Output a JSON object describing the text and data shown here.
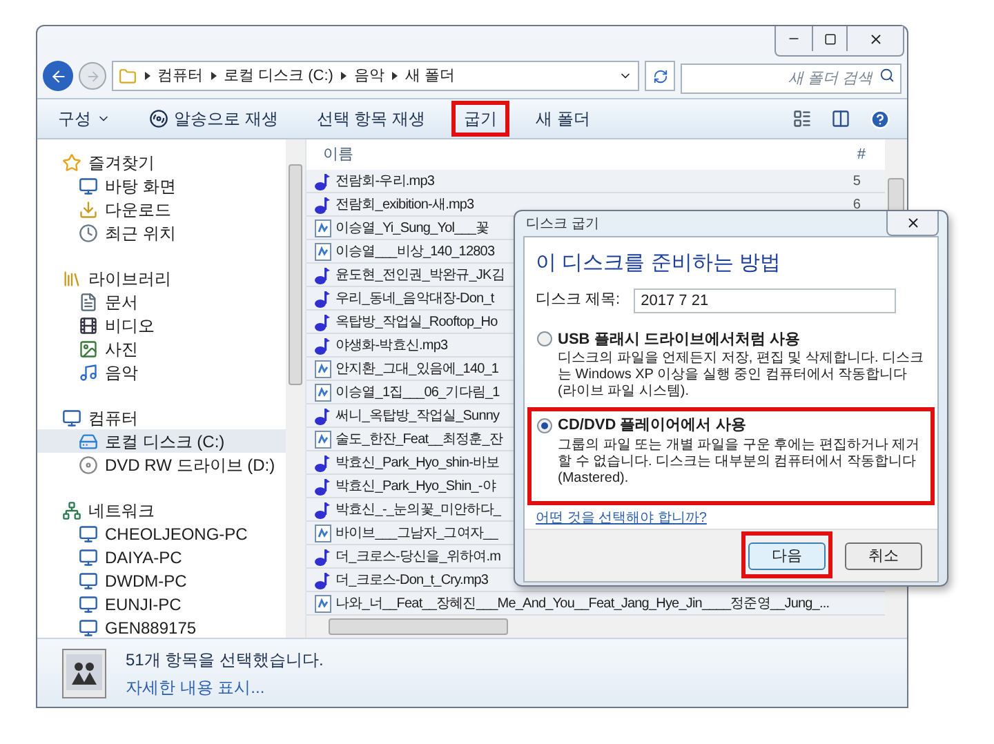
{
  "address": {
    "path": [
      {
        "label": "컴퓨터"
      },
      {
        "label": "로컬 디스크 (C:)"
      },
      {
        "label": "음악"
      },
      {
        "label": "새 폴더"
      }
    ],
    "search": {
      "placeholder": "새 폴더 검색"
    }
  },
  "toolbar": [
    {
      "label": "구성",
      "kind": "menu",
      "highlighted": false
    },
    {
      "label": "알송으로 재생",
      "kind": "play",
      "highlighted": false
    },
    {
      "label": "선택 항목 재생",
      "kind": "plain",
      "highlighted": false
    },
    {
      "label": "굽기",
      "kind": "plain",
      "highlighted": true
    },
    {
      "label": "새 폴더",
      "kind": "plain",
      "highlighted": false
    }
  ],
  "sidebar": {
    "sections": [
      {
        "label": "즐겨찾기",
        "kind": "star",
        "selected": false,
        "children": [
          {
            "label": "바탕 화면",
            "kind": "desktop",
            "selected": false
          },
          {
            "label": "다운로드",
            "kind": "download",
            "selected": false
          },
          {
            "label": "최근 위치",
            "kind": "recent",
            "selected": false
          }
        ]
      },
      {
        "label": "라이브러리",
        "kind": "library",
        "selected": false,
        "children": [
          {
            "label": "문서",
            "kind": "doc",
            "selected": false
          },
          {
            "label": "비디오",
            "kind": "video",
            "selected": false
          },
          {
            "label": "사진",
            "kind": "photo",
            "selected": false
          },
          {
            "label": "음악",
            "kind": "music",
            "selected": false
          }
        ]
      },
      {
        "label": "컴퓨터",
        "kind": "computer",
        "selected": false,
        "children": [
          {
            "label": "로컬 디스크 (C:)",
            "kind": "disk",
            "selected": true
          },
          {
            "label": "DVD RW 드라이브 (D:)",
            "kind": "dvd",
            "selected": false
          }
        ]
      },
      {
        "label": "네트워크",
        "kind": "network",
        "selected": false,
        "children": [
          {
            "label": "CHEOLJEONG-PC",
            "kind": "computer",
            "selected": false
          },
          {
            "label": "DAIYA-PC",
            "kind": "computer",
            "selected": false
          },
          {
            "label": "DWDM-PC",
            "kind": "computer",
            "selected": false
          },
          {
            "label": "EUNJI-PC",
            "kind": "computer",
            "selected": false
          },
          {
            "label": "GEN889175",
            "kind": "computer",
            "selected": false
          }
        ]
      }
    ]
  },
  "table": {
    "columns": [
      {
        "label": "이름"
      },
      {
        "label": "#"
      }
    ],
    "rows": [
      {
        "name": "전람회-우리.mp3",
        "number": "5",
        "kind": "note",
        "selected": true
      },
      {
        "name": "전람회_exibition-새.mp3",
        "number": "6",
        "kind": "note",
        "selected": true
      },
      {
        "name": "이승열_Yi_Sung_Yol___꽃",
        "kind": "file",
        "selected": true
      },
      {
        "name": "이승열___비상_140_12803",
        "kind": "file",
        "selected": true
      },
      {
        "name": "윤도현_전인권_박완규_JK김",
        "kind": "note",
        "selected": true
      },
      {
        "name": "우리_동네_음악대장-Don_t",
        "kind": "note",
        "selected": true
      },
      {
        "name": "옥탑방_작업실_Rooftop_Ho",
        "kind": "note",
        "selected": true
      },
      {
        "name": "야생화-박효신.mp3",
        "kind": "note",
        "selected": true
      },
      {
        "name": "안지환_그대_있음에_140_1",
        "kind": "file",
        "selected": true
      },
      {
        "name": "이승열_1집___06_기다림_1",
        "kind": "file",
        "selected": true
      },
      {
        "name": "써니_옥탑방_작업실_Sunny",
        "kind": "note",
        "selected": true
      },
      {
        "name": "술도_한잔_Feat__최정훈_잔",
        "kind": "file",
        "selected": true
      },
      {
        "name": "박효신_Park_Hyo_shin-바보",
        "kind": "note",
        "selected": true
      },
      {
        "name": "박효신_Park_Hyo_Shin_-야",
        "kind": "note",
        "selected": true
      },
      {
        "name": "박효신_-_눈의꽃_미안하다_",
        "kind": "note",
        "selected": true
      },
      {
        "name": "바이브___그남자_그여자__",
        "kind": "file",
        "selected": true
      },
      {
        "name": "더_크로스-당신을_위하여.m",
        "kind": "note",
        "selected": true
      },
      {
        "name": "더_크로스-Don_t_Cry.mp3",
        "kind": "note",
        "selected": true
      },
      {
        "name": "나와_너__Feat__장혜진___Me_And_You__Feat_Jang_Hye_Jin____정준영__Jung_...",
        "kind": "file",
        "selected": true
      }
    ]
  },
  "details": {
    "summary": "51개 항목을 선택했습니다.",
    "link": "자세한 내용 표시..."
  },
  "dialog": {
    "title": "디스크 굽기",
    "heading": "이 디스크를 준비하는 방법",
    "field": {
      "label": "디스크 제목:",
      "value": "2017 7 21"
    },
    "options": [
      {
        "label": "USB 플래시 드라이브에서처럼 사용",
        "description": "디스크의 파일을 언제든지 저장, 편집 및 삭제합니다. 디스크는 Windows XP 이상을 실행 중인 컴퓨터에서 작동합니다(라이브 파일 시스템).",
        "selected": false,
        "highlighted": false
      },
      {
        "label": "CD/DVD 플레이어에서 사용",
        "description": "그룹의 파일 또는 개별 파일을 구운 후에는 편집하거나 제거할 수 없습니다. 디스크는 대부분의 컴퓨터에서 작동합니다 (Mastered).",
        "selected": true,
        "highlighted": true
      }
    ],
    "help_link": "어떤 것을 선택해야 합니까?",
    "buttons": [
      {
        "label": "다음",
        "highlighted": true
      },
      {
        "label": "취소",
        "highlighted": false
      }
    ]
  }
}
